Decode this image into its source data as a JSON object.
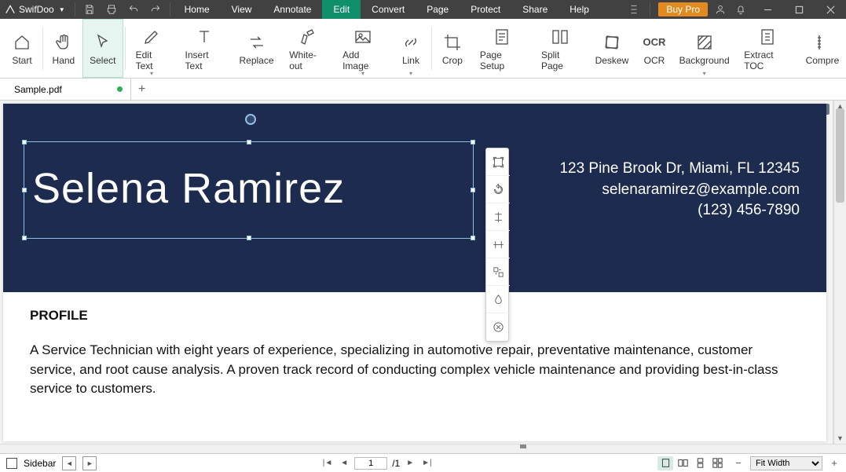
{
  "app": {
    "name": "SwifDoo",
    "buy_label": "Buy Pro"
  },
  "menu": {
    "items": [
      "Home",
      "View",
      "Annotate",
      "Edit",
      "Convert",
      "Page",
      "Protect",
      "Share",
      "Help"
    ],
    "active": "Edit"
  },
  "ribbon": {
    "items": [
      {
        "label": "Start"
      },
      {
        "label": "Hand"
      },
      {
        "label": "Select"
      },
      {
        "label": "Edit Text"
      },
      {
        "label": "Insert Text"
      },
      {
        "label": "Replace"
      },
      {
        "label": "White-out"
      },
      {
        "label": "Add Image"
      },
      {
        "label": "Link"
      },
      {
        "label": "Crop"
      },
      {
        "label": "Page Setup"
      },
      {
        "label": "Split Page"
      },
      {
        "label": "Deskew"
      },
      {
        "label": "OCR"
      },
      {
        "label": "Background"
      },
      {
        "label": "Extract TOC"
      },
      {
        "label": "Compre"
      }
    ],
    "selected": "Select"
  },
  "tabs": {
    "name": "Sample.pdf"
  },
  "page_badge": "1",
  "document": {
    "name": "Selena Ramirez",
    "contact": {
      "address": "123 Pine Brook Dr, Miami, FL 12345",
      "email": "selenaramirez@example.com",
      "phone": "(123) 456-7890"
    },
    "profile_heading": "PROFILE",
    "profile_text": "A Service Technician with eight years of experience, specializing in automotive repair, preventative maintenance, customer service, and root cause analysis. A proven track record of conducting complex vehicle maintenance and providing best-in-class service to customers."
  },
  "status": {
    "sidebar_label": "Sidebar",
    "page_current": "1",
    "page_total": "/1",
    "zoom_label": "Fit Width"
  }
}
